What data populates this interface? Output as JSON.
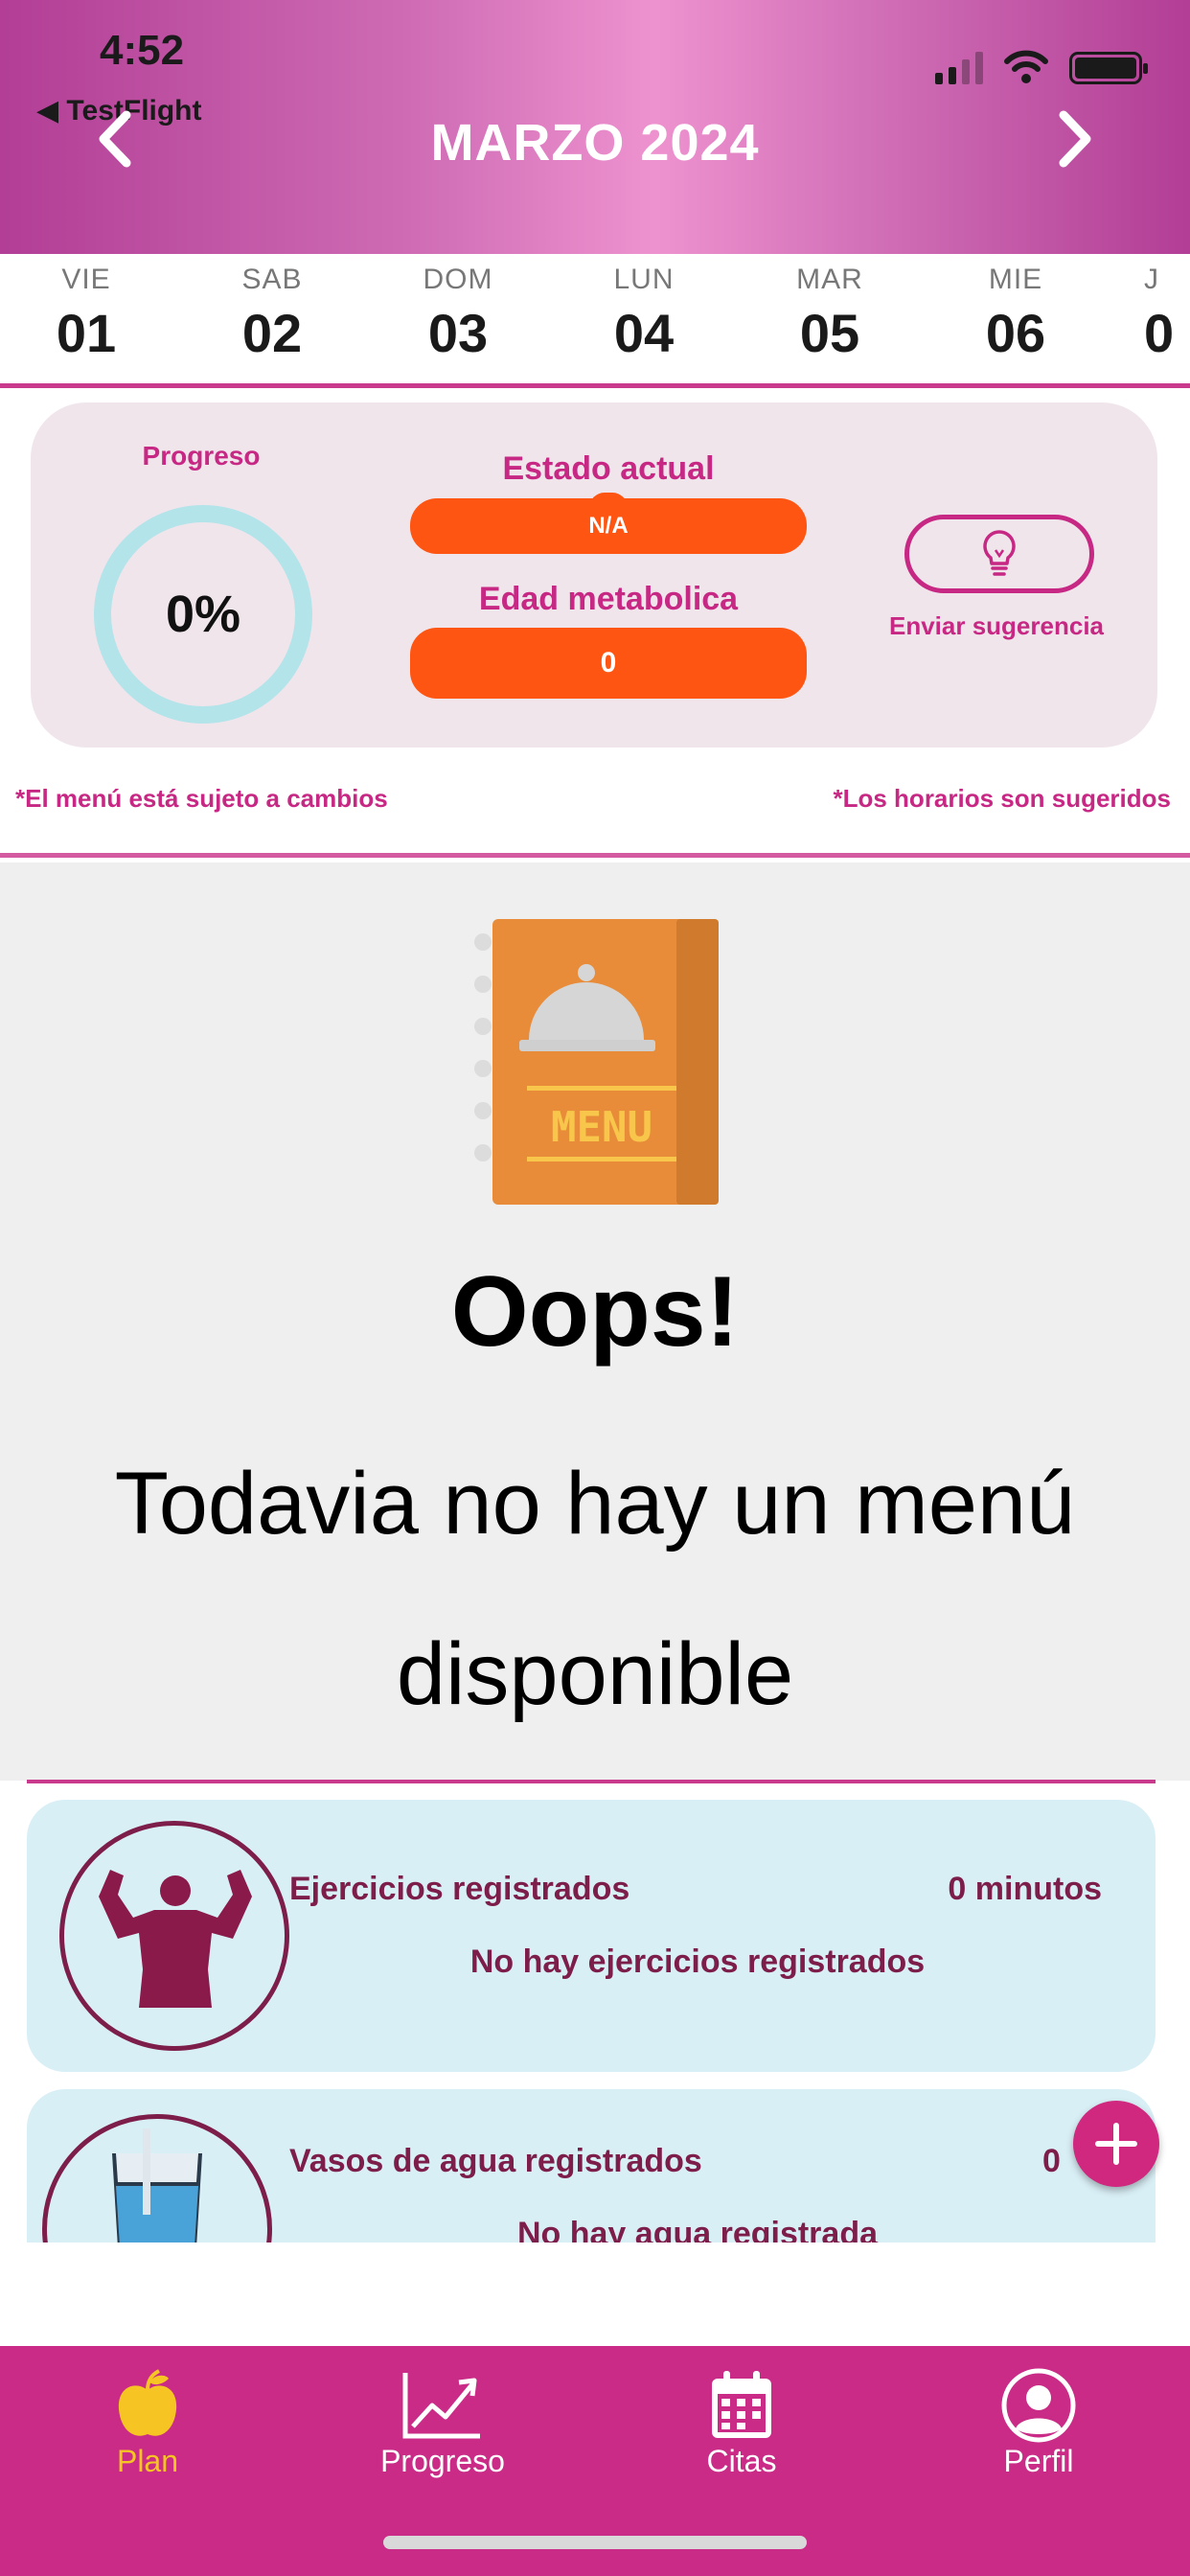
{
  "status_bar": {
    "time": "4:52",
    "back_app": "◀ TestFlight",
    "icons": [
      "signal-icon",
      "wifi-icon",
      "battery-icon"
    ]
  },
  "header": {
    "title": "MARZO 2024",
    "prev_icon": "chevron-left-icon",
    "next_icon": "chevron-right-icon"
  },
  "days": [
    {
      "name": "VIE",
      "num": "01"
    },
    {
      "name": "SAB",
      "num": "02"
    },
    {
      "name": "DOM",
      "num": "03"
    },
    {
      "name": "LUN",
      "num": "04"
    },
    {
      "name": "MAR",
      "num": "05"
    },
    {
      "name": "MIE",
      "num": "06"
    },
    {
      "name": "J",
      "num": "0"
    }
  ],
  "stats": {
    "progress_label": "Progreso",
    "progress_value": "0%",
    "estado_label": "Estado actual",
    "estado_value": "N/A",
    "edad_label": "Edad metabolica",
    "edad_value": "0",
    "suggest_label": "Enviar sugerencia",
    "suggest_icon": "lightbulb-icon"
  },
  "notes": {
    "left": "*El menú está sujeto a cambios",
    "right": "*Los horarios son sugeridos"
  },
  "empty_menu": {
    "illustration": "menu-book-icon",
    "illustration_text": "MENU",
    "title": "Oops!",
    "message": "Todavia no hay un menú disponible"
  },
  "exercise_card": {
    "title": "Ejercicios registrados",
    "value": "0 minutos",
    "subtitle": "No hay ejercicios registrados",
    "icon": "muscle-man-icon"
  },
  "water_card": {
    "title": "Vasos de agua registrados",
    "value": "0",
    "subtitle": "No hay agua registrada",
    "icon": "water-glass-icon"
  },
  "fab_icon": "plus-icon",
  "bottom_nav": [
    {
      "label": "Plan",
      "icon": "apple-icon",
      "active": true
    },
    {
      "label": "Progreso",
      "icon": "chart-icon",
      "active": false
    },
    {
      "label": "Citas",
      "icon": "calendar-icon",
      "active": false
    },
    {
      "label": "Perfil",
      "icon": "profile-icon",
      "active": false
    }
  ],
  "colors": {
    "accent": "#c62884",
    "orange": "#ff5512",
    "nav_bg": "#c92b87",
    "card_bg": "#d9eff6",
    "active_tab": "#f6c523"
  }
}
